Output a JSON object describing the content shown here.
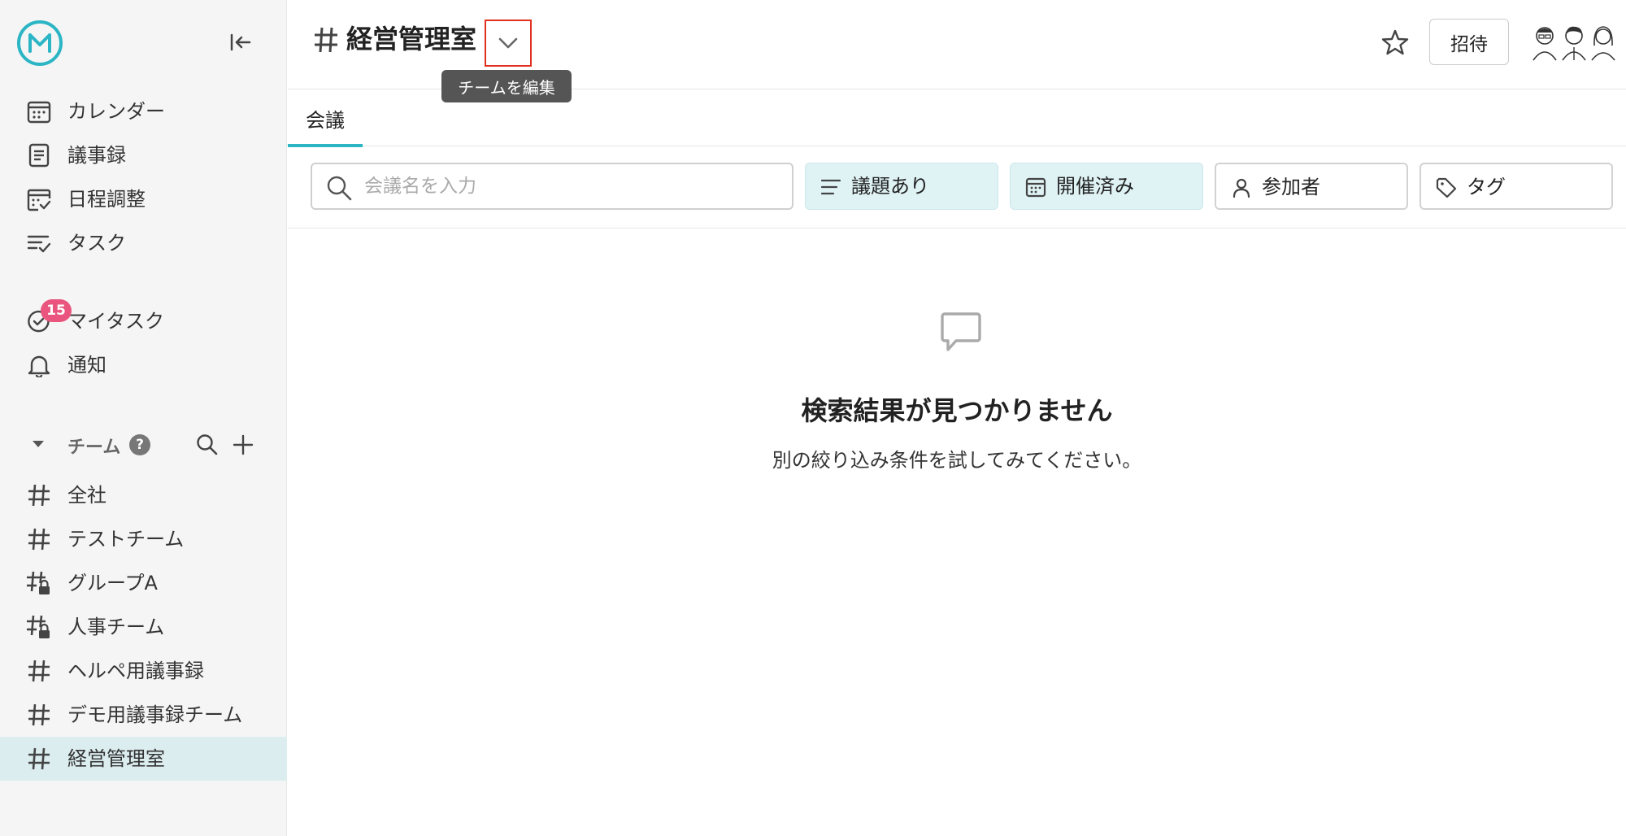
{
  "sidebar": {
    "nav": [
      {
        "label": "カレンダー",
        "icon": "calendar-icon"
      },
      {
        "label": "議事録",
        "icon": "document-icon"
      },
      {
        "label": "日程調整",
        "icon": "schedule-check-icon"
      },
      {
        "label": "タスク",
        "icon": "task-list-icon"
      }
    ],
    "personal": [
      {
        "label": "マイタスク",
        "icon": "check-circle-icon",
        "badge": "15"
      },
      {
        "label": "通知",
        "icon": "bell-icon"
      }
    ],
    "team_section_label": "チーム",
    "help_label": "?",
    "teams": [
      {
        "label": "全社",
        "icon": "hash-icon"
      },
      {
        "label": "テストチーム",
        "icon": "hash-icon"
      },
      {
        "label": "グループA",
        "icon": "hash-lock-icon"
      },
      {
        "label": "人事チーム",
        "icon": "hash-lock-icon"
      },
      {
        "label": "ヘルペ用議事録",
        "icon": "hash-icon"
      },
      {
        "label": "デモ用議事録チーム",
        "icon": "hash-icon"
      },
      {
        "label": "経営管理室",
        "icon": "hash-icon",
        "active": true
      }
    ]
  },
  "header": {
    "title": "経営管理室",
    "tooltip": "チームを編集",
    "invite_label": "招待"
  },
  "tabs": [
    {
      "label": "会議",
      "active": true
    }
  ],
  "filters": {
    "search_placeholder": "会議名を入力",
    "search_value": "",
    "chips": [
      {
        "label": "議題あり",
        "icon": "lines-icon",
        "active": true
      },
      {
        "label": "開催済み",
        "icon": "calendar-icon",
        "active": true
      },
      {
        "label": "参加者",
        "icon": "person-icon",
        "active": false
      },
      {
        "label": "タグ",
        "icon": "tag-icon",
        "active": false
      }
    ]
  },
  "empty_state": {
    "icon": "speech-bubble-icon",
    "title": "検索結果が見つかりません",
    "subtitle": "別の絞り込み条件を試してみてください。"
  },
  "colors": {
    "accent": "#2bb5c5",
    "badge": "#e9557e",
    "active_bg": "#dcedef",
    "chip_active_bg": "#dff2f4",
    "highlight_border": "#e0301e"
  }
}
